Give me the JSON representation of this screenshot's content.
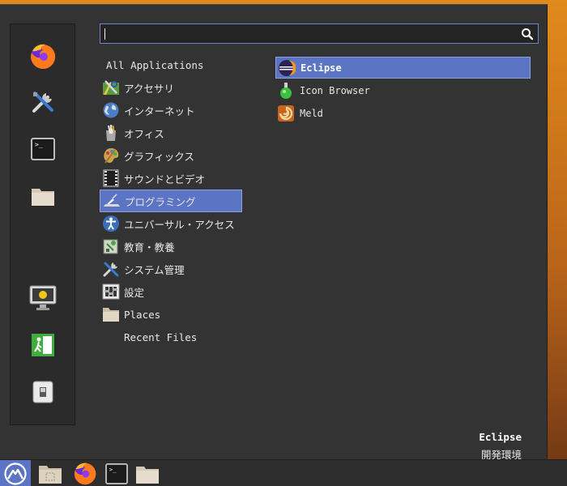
{
  "search": {
    "value": "",
    "placeholder": ""
  },
  "favorites": [
    {
      "icon": "firefox-icon"
    },
    {
      "icon": "tools-icon"
    },
    {
      "icon": "terminal-icon"
    },
    {
      "icon": "folder-icon"
    },
    {
      "icon": "lock-screen-icon"
    },
    {
      "icon": "logout-icon"
    },
    {
      "icon": "switch-user-icon"
    }
  ],
  "categories": [
    {
      "label": "All Applications",
      "icon": null
    },
    {
      "label": "アクセサリ",
      "icon": "accessories-icon"
    },
    {
      "label": "インターネット",
      "icon": "internet-icon"
    },
    {
      "label": "オフィス",
      "icon": "office-icon"
    },
    {
      "label": "グラフィックス",
      "icon": "graphics-icon"
    },
    {
      "label": "サウンドとビデオ",
      "icon": "sound-video-icon"
    },
    {
      "label": "プログラミング",
      "icon": "programming-icon",
      "selected": true
    },
    {
      "label": "ユニバーサル・アクセス",
      "icon": "accessibility-icon"
    },
    {
      "label": "教育・教養",
      "icon": "education-icon"
    },
    {
      "label": "システム管理",
      "icon": "system-tools-icon"
    },
    {
      "label": "設定",
      "icon": "settings-icon"
    },
    {
      "label": "Places",
      "icon": "places-folder-icon"
    },
    {
      "label": "Recent Files",
      "icon": null
    }
  ],
  "apps": [
    {
      "label": "Eclipse",
      "icon": "eclipse-icon",
      "selected": true
    },
    {
      "label": "Icon Browser",
      "icon": "icon-browser-icon"
    },
    {
      "label": "Meld",
      "icon": "meld-icon"
    }
  ],
  "detail": {
    "name": "Eclipse",
    "description": "開発環境"
  },
  "taskbar": [
    {
      "icon": "menu-start-icon"
    },
    {
      "icon": "file-manager-icon"
    },
    {
      "icon": "firefox-icon"
    },
    {
      "icon": "terminal-icon"
    },
    {
      "icon": "folder-icon"
    }
  ],
  "colors": {
    "accent": "#5b74c4",
    "menu_bg": "#333333",
    "sidebar_bg": "#2b2b2b",
    "taskbar_bg": "#2d2d2d"
  }
}
